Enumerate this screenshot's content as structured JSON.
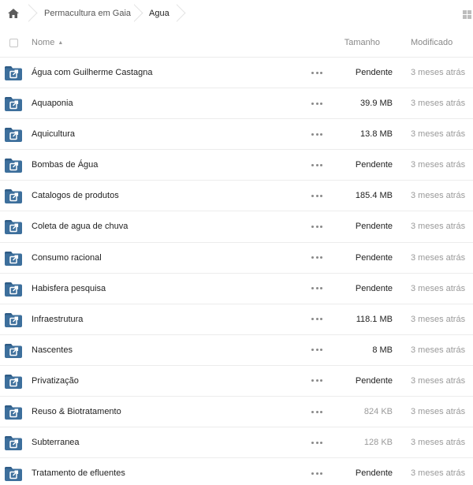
{
  "breadcrumb": {
    "home_icon": "home-icon",
    "items": [
      {
        "label": "Permacultura em Gaia"
      },
      {
        "label": "Agua"
      }
    ]
  },
  "view_toggle_icon": "grid-view-icon",
  "table": {
    "headers": {
      "name": "Nome",
      "size": "Tamanho",
      "modified": "Modificado"
    },
    "sort_indicator": "▲",
    "rows": [
      {
        "name": "Água com Guilherme Castagna",
        "size": "Pendente",
        "modified": "3 meses atrás",
        "faded": false
      },
      {
        "name": "Aquaponia",
        "size": "39.9 MB",
        "modified": "3 meses atrás",
        "faded": false
      },
      {
        "name": "Aquicultura",
        "size": "13.8 MB",
        "modified": "3 meses atrás",
        "faded": false
      },
      {
        "name": "Bombas de Água",
        "size": "Pendente",
        "modified": "3 meses atrás",
        "faded": false
      },
      {
        "name": "Catalogos de produtos",
        "size": "185.4 MB",
        "modified": "3 meses atrás",
        "faded": false
      },
      {
        "name": "Coleta de agua de chuva",
        "size": "Pendente",
        "modified": "3 meses atrás",
        "faded": false
      },
      {
        "name": "Consumo racional",
        "size": "Pendente",
        "modified": "3 meses atrás",
        "faded": false
      },
      {
        "name": "Habisfera pesquisa",
        "size": "Pendente",
        "modified": "3 meses atrás",
        "faded": false
      },
      {
        "name": "Infraestrutura",
        "size": "118.1 MB",
        "modified": "3 meses atrás",
        "faded": false
      },
      {
        "name": "Nascentes",
        "size": "8 MB",
        "modified": "3 meses atrás",
        "faded": false
      },
      {
        "name": "Privatização",
        "size": "Pendente",
        "modified": "3 meses atrás",
        "faded": false
      },
      {
        "name": "Reuso & Biotratamento",
        "size": "824 KB",
        "modified": "3 meses atrás",
        "faded": true
      },
      {
        "name": "Subterranea",
        "size": "128 KB",
        "modified": "3 meses atrás",
        "faded": true
      },
      {
        "name": "Tratamento de efluentes",
        "size": "Pendente",
        "modified": "3 meses atrás",
        "faded": false
      }
    ]
  },
  "colors": {
    "folder": "#3d6f9c",
    "folder_tab": "#2f5c86",
    "divider": "#ececec",
    "muted_text": "#9a9a9a"
  }
}
